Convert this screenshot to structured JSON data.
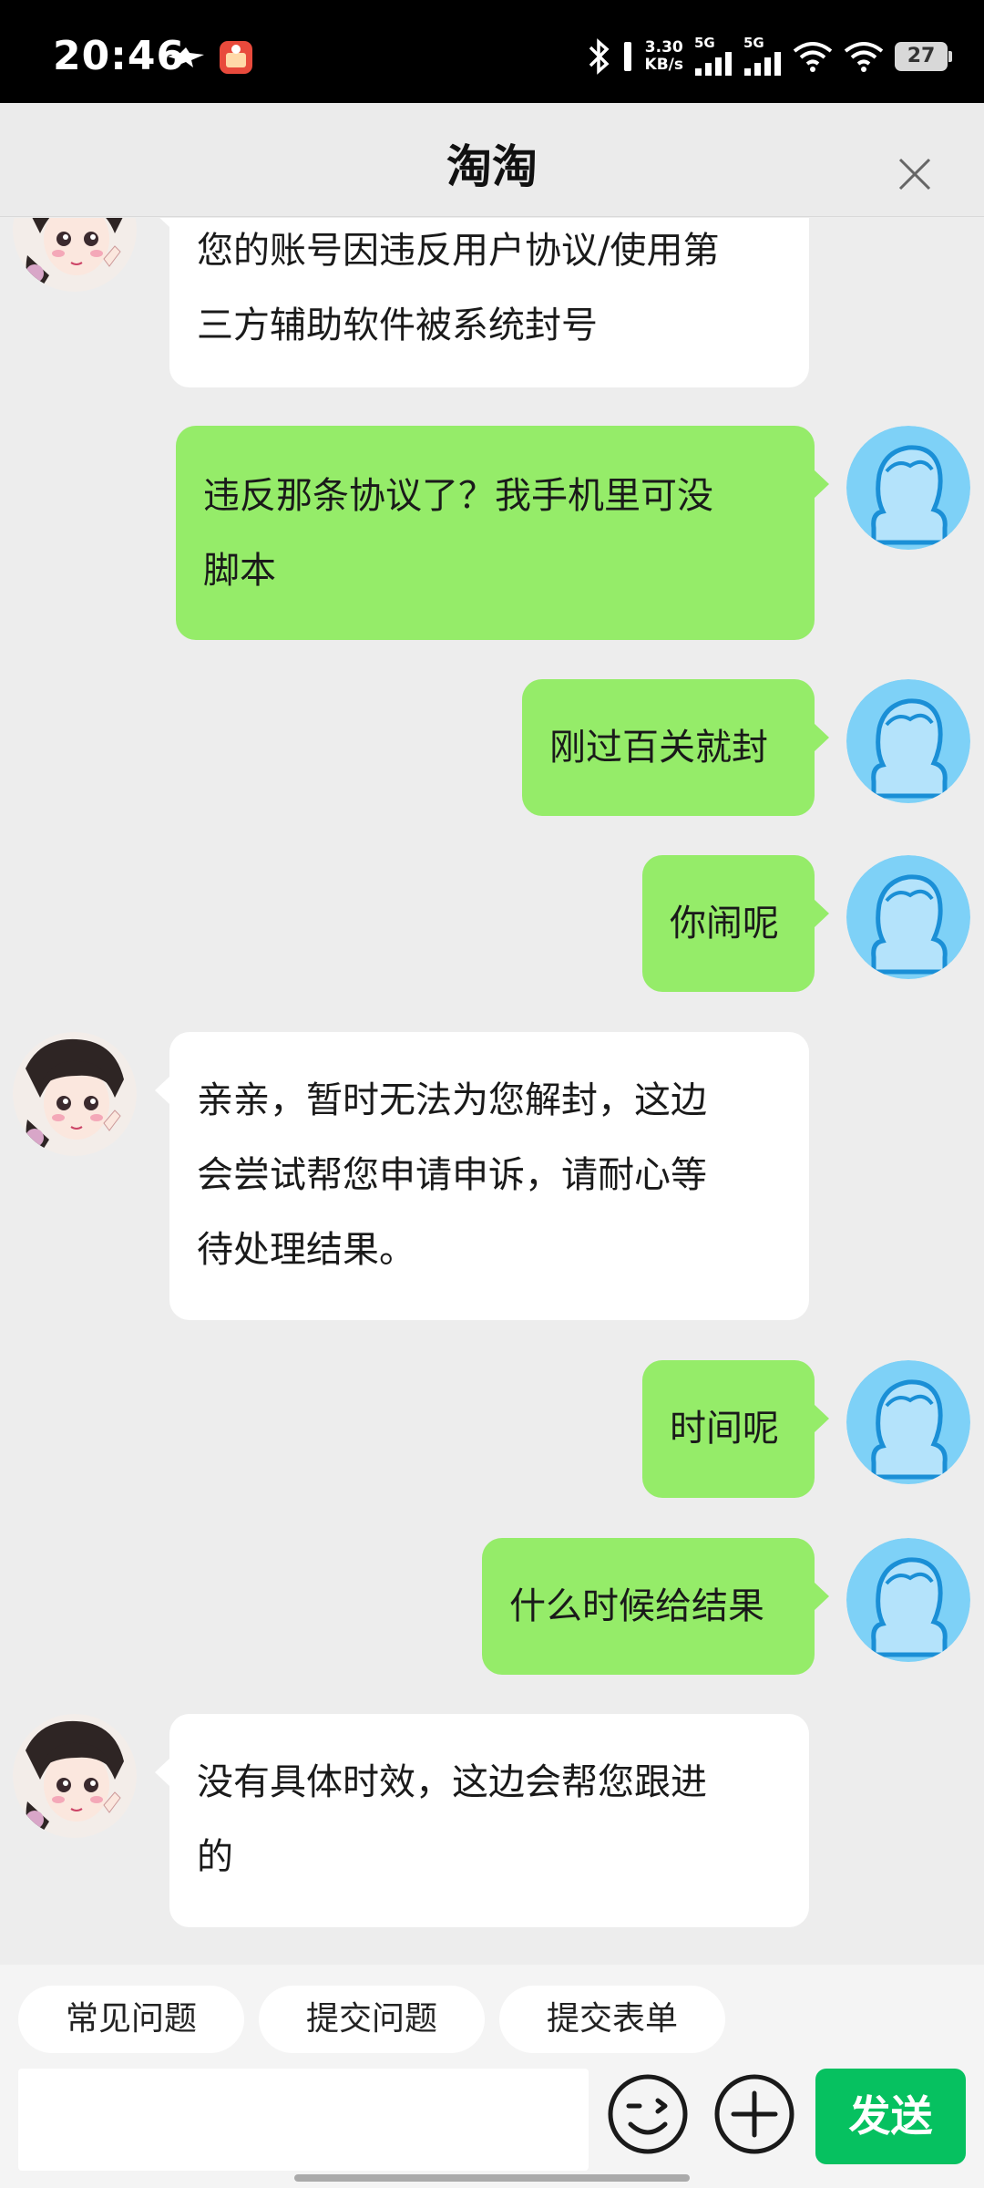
{
  "status_bar": {
    "time": "20:46",
    "net_speed_value": "3.30",
    "net_speed_unit": "KB/s",
    "signal1_label": "5G",
    "signal2_label": "5G",
    "battery": "27",
    "icons": [
      "bird-icon",
      "app-icon",
      "bluetooth-icon",
      "signal-icon",
      "signal-icon",
      "wifi-icon",
      "wifi-icon",
      "battery-icon"
    ]
  },
  "header": {
    "title": "淘淘"
  },
  "messages": [
    {
      "side": "in",
      "lines": [
        "您的账号因违反用户协议/使用第",
        "三方辅助软件被系统封号"
      ]
    },
    {
      "side": "out",
      "lines": [
        "违反那条协议了？我手机里可没",
        "脚本"
      ]
    },
    {
      "side": "out",
      "lines": [
        "刚过百关就封"
      ]
    },
    {
      "side": "out",
      "lines": [
        "你闹呢"
      ]
    },
    {
      "side": "in",
      "lines": [
        "亲亲，暂时无法为您解封，这边",
        "会尝试帮您申请申诉，请耐心等",
        "待处理结果。"
      ]
    },
    {
      "side": "out",
      "lines": [
        "时间呢"
      ]
    },
    {
      "side": "out",
      "lines": [
        "什么时候给结果"
      ]
    },
    {
      "side": "in",
      "lines": [
        "没有具体时效，这边会帮您跟进",
        "的"
      ]
    }
  ],
  "quick_replies": [
    "常见问题",
    "提交问题",
    "提交表单"
  ],
  "input": {
    "value": "",
    "placeholder": ""
  },
  "send_label": "发送",
  "colors": {
    "outgoing_bubble": "#95ec69",
    "incoming_bubble": "#ffffff",
    "send_button": "#06c160",
    "user_avatar": "#7ed1f7"
  }
}
